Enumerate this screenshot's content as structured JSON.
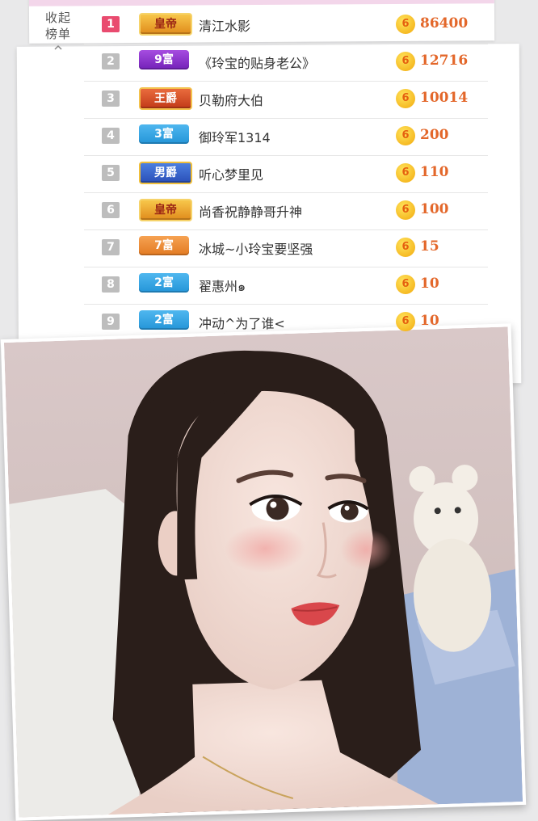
{
  "collapse": {
    "label": "收起榜单"
  },
  "leaderboard": {
    "rows": [
      {
        "rank": "1",
        "badge": "皇帝",
        "name": "清江水影",
        "coins": "86400"
      },
      {
        "rank": "2",
        "badge": "9富",
        "name": "《玲宝的贴身老公》",
        "coins": "12716"
      },
      {
        "rank": "3",
        "badge": "王爵",
        "name": "贝勒府大伯",
        "coins": "10014"
      },
      {
        "rank": "4",
        "badge": "3富",
        "name": "御玲军1314",
        "coins": "200"
      },
      {
        "rank": "5",
        "badge": "男爵",
        "name": "听心梦里见",
        "coins": "110"
      },
      {
        "rank": "6",
        "badge": "皇帝",
        "name": "尚香祝静静哥升神",
        "coins": "100"
      },
      {
        "rank": "7",
        "badge": "7富",
        "name": "冰城~小玲宝要坚强",
        "coins": "15"
      },
      {
        "rank": "8",
        "badge": "2富",
        "name": "翟惠州๑",
        "coins": "10"
      },
      {
        "rank": "9",
        "badge": "2富",
        "name": "冲动^为了谁<",
        "coins": "10"
      }
    ],
    "coin_symbol": "6"
  }
}
